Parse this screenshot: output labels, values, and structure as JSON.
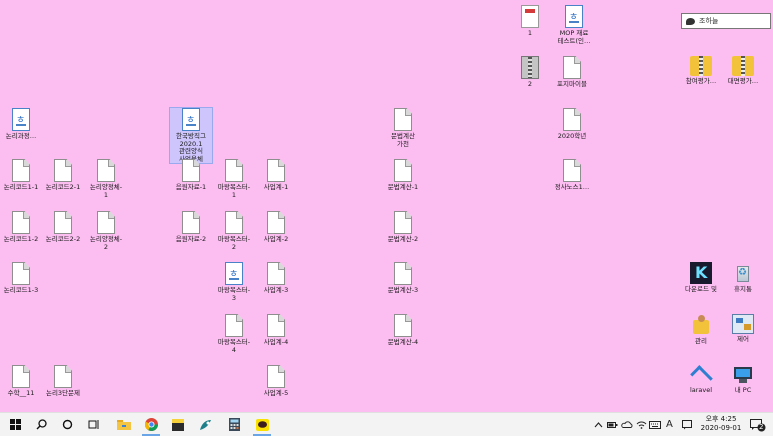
{
  "desktop_icons": [
    {
      "name": "desktop-icon-1",
      "type": "red",
      "label": "1"
    },
    {
      "name": "desktop-icon-2",
      "type": "hwp",
      "label": "MOP 재료\n테스트(인…"
    },
    {
      "name": "desktop-icon-3",
      "type": "zip",
      "label": "2"
    },
    {
      "name": "desktop-icon-4",
      "type": "doc",
      "label": "포지마이블"
    },
    {
      "name": "desktop-icon-5",
      "type": "folder",
      "label": "참여평가…"
    },
    {
      "name": "desktop-icon-6",
      "type": "folder",
      "label": "대면평가…"
    },
    {
      "name": "desktop-icon-7",
      "type": "hwp",
      "label": "논리과정…"
    },
    {
      "name": "desktop-icon-8",
      "type": "hwp",
      "label": "한국방직그\n2020.1\n관련양식\n사업용체"
    },
    {
      "name": "desktop-icon-9",
      "type": "doc",
      "label": "문법계산\n가천"
    },
    {
      "name": "desktop-icon-10",
      "type": "doc",
      "label": "2020학년"
    },
    {
      "name": "desktop-icon-11",
      "type": "doc",
      "label": "논리코드1-1"
    },
    {
      "name": "desktop-icon-12",
      "type": "doc",
      "label": "논리코드2-1"
    },
    {
      "name": "desktop-icon-13",
      "type": "doc",
      "label": "논리양정체-\n1"
    },
    {
      "name": "desktop-icon-14",
      "type": "doc",
      "label": "음원자료-1"
    },
    {
      "name": "desktop-icon-15",
      "type": "doc",
      "label": "마왕목스터-\n1"
    },
    {
      "name": "desktop-icon-16",
      "type": "doc",
      "label": "사업계-1"
    },
    {
      "name": "desktop-icon-17",
      "type": "doc",
      "label": "문법계산-1"
    },
    {
      "name": "desktop-icon-18",
      "type": "doc",
      "label": "정사노스1…"
    },
    {
      "name": "desktop-icon-19",
      "type": "doc",
      "label": "논리코드1-2"
    },
    {
      "name": "desktop-icon-20",
      "type": "doc",
      "label": "논리코드2-2"
    },
    {
      "name": "desktop-icon-21",
      "type": "doc",
      "label": "논리양정체-\n2"
    },
    {
      "name": "desktop-icon-22",
      "type": "doc",
      "label": "음원자료-2"
    },
    {
      "name": "desktop-icon-23",
      "type": "doc",
      "label": "마왕목스터-\n2"
    },
    {
      "name": "desktop-icon-24",
      "type": "doc",
      "label": "사업계-2"
    },
    {
      "name": "desktop-icon-25",
      "type": "doc",
      "label": "문법계산-2"
    },
    {
      "name": "desktop-icon-26",
      "type": "doc",
      "label": "논리코드1-3"
    },
    {
      "name": "desktop-icon-27",
      "type": "hwp",
      "label": "마왕목스터-\n3"
    },
    {
      "name": "desktop-icon-28",
      "type": "doc",
      "label": "사업계-3"
    },
    {
      "name": "desktop-icon-29",
      "type": "doc",
      "label": "문법계산-3"
    },
    {
      "name": "desktop-icon-30",
      "type": "kakao",
      "label": "다운로드 및"
    },
    {
      "name": "desktop-icon-31",
      "type": "bin",
      "label": "휴지통"
    },
    {
      "name": "desktop-icon-32",
      "type": "doc",
      "label": "마왕목스터-\n4"
    },
    {
      "name": "desktop-icon-33",
      "type": "doc",
      "label": "사업계-4"
    },
    {
      "name": "desktop-icon-34",
      "type": "doc",
      "label": "문법계산-4"
    },
    {
      "name": "desktop-icon-35",
      "type": "user",
      "label": "관리"
    },
    {
      "name": "desktop-icon-36",
      "type": "ctrl",
      "label": "제어"
    },
    {
      "name": "desktop-icon-37",
      "type": "doc",
      "label": "수학__11"
    },
    {
      "name": "desktop-icon-38",
      "type": "doc",
      "label": "논리3단문제"
    },
    {
      "name": "desktop-icon-39",
      "type": "doc",
      "label": "사업계-5"
    },
    {
      "name": "desktop-icon-40",
      "type": "net",
      "label": "laravel"
    },
    {
      "name": "desktop-icon-41",
      "type": "pc",
      "label": "내 PC"
    }
  ],
  "search_widget": {
    "text": "조하늘"
  },
  "taskbar": {
    "buttons": [
      {
        "name": "start-button",
        "icon": "windows-logo-icon"
      },
      {
        "name": "search-button",
        "icon": "search-icon"
      },
      {
        "name": "cortana-button",
        "icon": "cortana-icon"
      },
      {
        "name": "task-view-button",
        "icon": "task-view-icon"
      },
      {
        "name": "file-explorer-button",
        "icon": "folder-icon"
      },
      {
        "name": "chrome-button",
        "icon": "chrome-icon"
      },
      {
        "name": "sticky-notes-button",
        "icon": "notes-icon"
      },
      {
        "name": "app-button",
        "icon": "app-icon"
      },
      {
        "name": "calculator-button",
        "icon": "calculator-icon"
      },
      {
        "name": "kakaotalk-button",
        "icon": "kakaotalk-icon"
      }
    ],
    "tray": {
      "ime": "A",
      "time": "오후 4:25",
      "date": "2020-09-01",
      "notifications": "2"
    }
  },
  "colors": {
    "desktop": "#fcbdf1",
    "taskbar": "#f3f3f3"
  }
}
